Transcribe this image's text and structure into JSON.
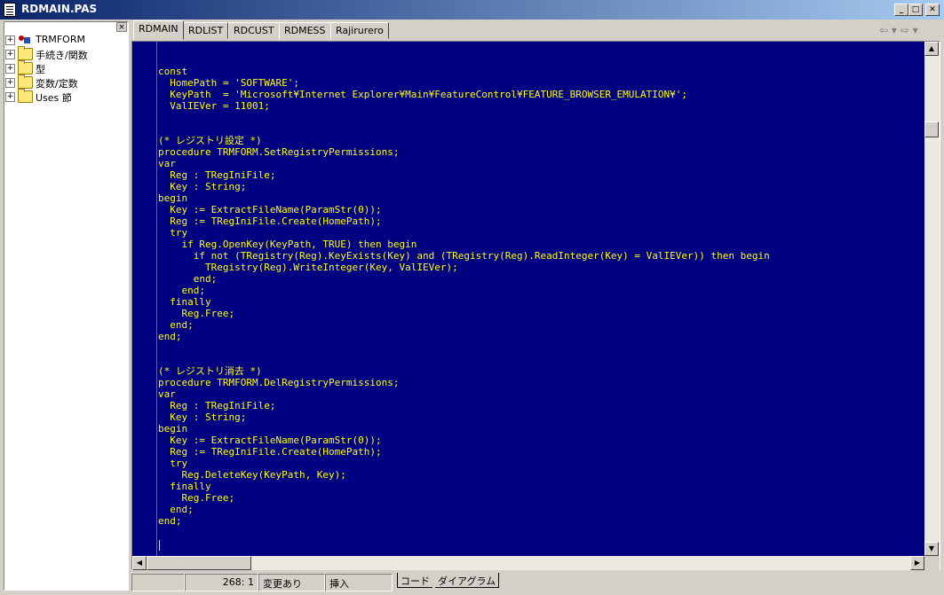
{
  "window": {
    "title": "RDMAIN.PAS",
    "min_glyph": "_",
    "max_glyph": "□",
    "close_glyph": "✕"
  },
  "tree": {
    "close_glyph": "×",
    "items": [
      {
        "label": "TRMFORM",
        "icon": "form-icon"
      },
      {
        "label": "手続き/関数",
        "icon": "folder-icon"
      },
      {
        "label": "型",
        "icon": "folder-icon"
      },
      {
        "label": "変数/定数",
        "icon": "folder-icon"
      },
      {
        "label": "Uses 節",
        "icon": "folder-icon"
      }
    ],
    "expand_glyph": "+"
  },
  "tabs": [
    "RDMAIN",
    "RDLIST",
    "RDCUST",
    "RDMESS",
    "Rajirurero"
  ],
  "nav": {
    "back": "⇦ ▾",
    "forward": "⇨ ▾"
  },
  "editor": {
    "code": "const\n  HomePath = 'SOFTWARE';\n  KeyPath  = 'Microsoft¥Internet Explorer¥Main¥FeatureControl¥FEATURE_BROWSER_EMULATION¥';\n  ValIEVer = 11001;\n\n\n(* レジストリ設定 *)\nprocedure TRMFORM.SetRegistryPermissions;\nvar\n  Reg : TRegIniFile;\n  Key : String;\nbegin\n  Key := ExtractFileName(ParamStr(0));\n  Reg := TRegIniFile.Create(HomePath);\n  try\n    if Reg.OpenKey(KeyPath, TRUE) then begin\n      if not (TRegistry(Reg).KeyExists(Key) and (TRegistry(Reg).ReadInteger(Key) = ValIEVer)) then begin\n        TRegistry(Reg).WriteInteger(Key, ValIEVer);\n      end;\n    end;\n  finally\n    Reg.Free;\n  end;\nend;\n\n\n(* レジストリ消去 *)\nprocedure TRMFORM.DelRegistryPermissions;\nvar\n  Reg : TRegIniFile;\n  Key : String;\nbegin\n  Key := ExtractFileName(ParamStr(0));\n  Reg := TRegIniFile.Create(HomePath);\n  try\n    Reg.DeleteKey(KeyPath, Key);\n  finally\n    Reg.Free;\n  end;\nend;",
    "colors": {
      "background": "#000080",
      "text": "#ffff00"
    }
  },
  "scroll": {
    "up": "▲",
    "down": "▼",
    "left": "◀",
    "right": "▶"
  },
  "status": {
    "position": "268:  1",
    "modified": "変更あり",
    "mode": "挿入",
    "tab_code": "コード",
    "tab_diagram": "ダイアグラム"
  }
}
